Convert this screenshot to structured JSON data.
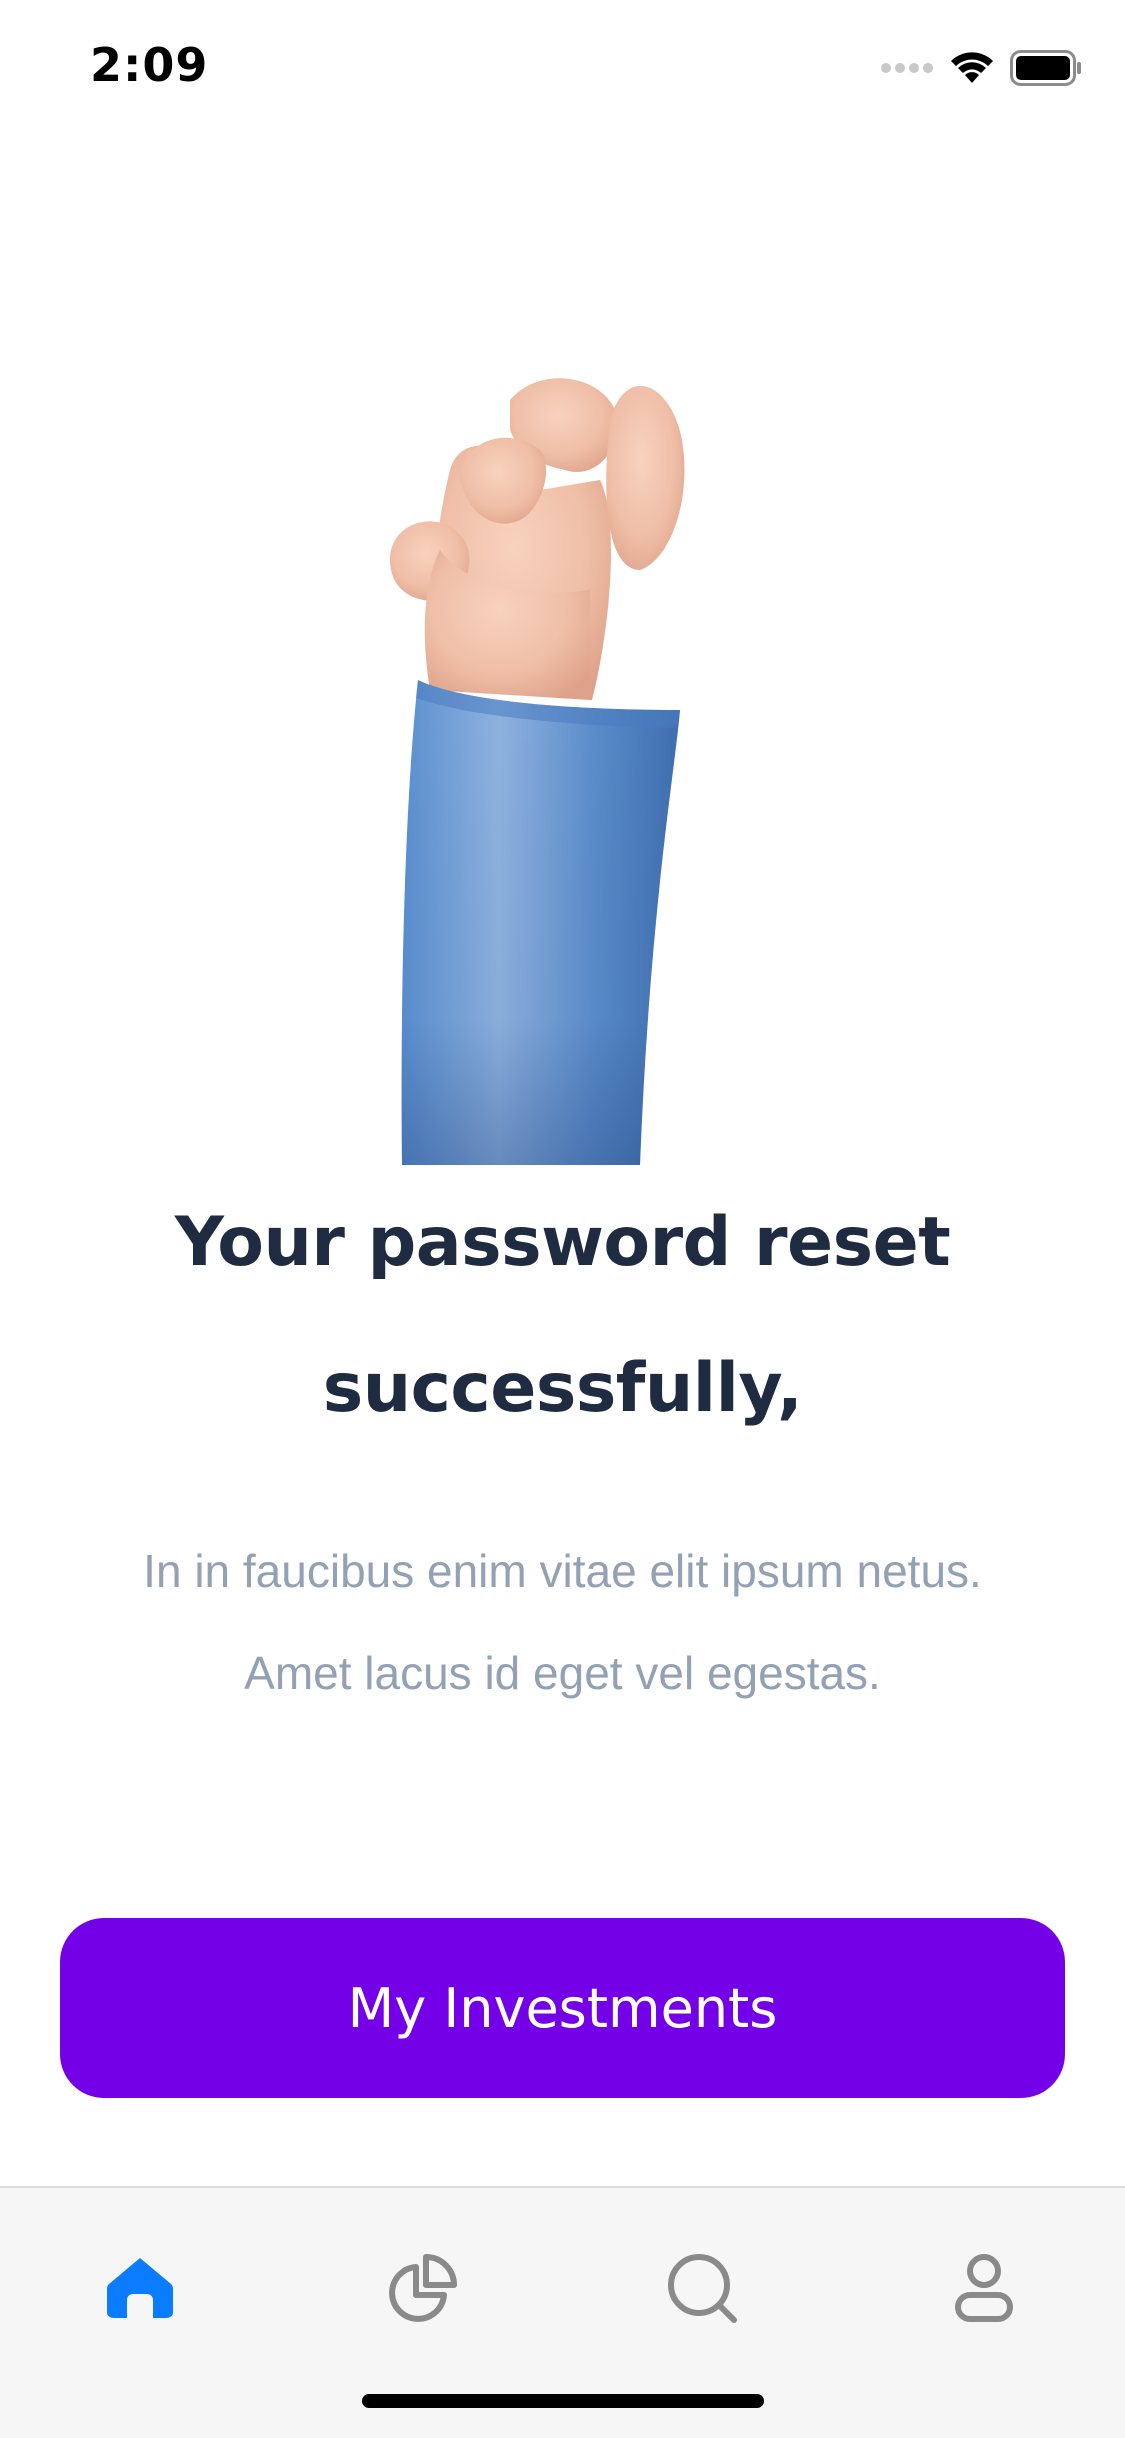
{
  "status_bar": {
    "time": "2:09"
  },
  "main": {
    "title_line1": "Your password reset",
    "title_line2": "successfully,",
    "subtitle_line1": "In in faucibus enim vitae elit ipsum netus.",
    "subtitle_line2": "Amet lacus id eget vel egestas.",
    "cta_label": "My Investments"
  },
  "tab_bar": {
    "items": [
      {
        "icon": "home-icon",
        "active": true
      },
      {
        "icon": "pie-chart-icon",
        "active": false
      },
      {
        "icon": "search-icon",
        "active": false
      },
      {
        "icon": "profile-icon",
        "active": false
      }
    ]
  },
  "colors": {
    "accent": "#7400e8",
    "title": "#1f2b40",
    "subtitle": "#93a1b5",
    "tab_active": "#0a7cff",
    "tab_inactive": "#8a8a8a"
  }
}
